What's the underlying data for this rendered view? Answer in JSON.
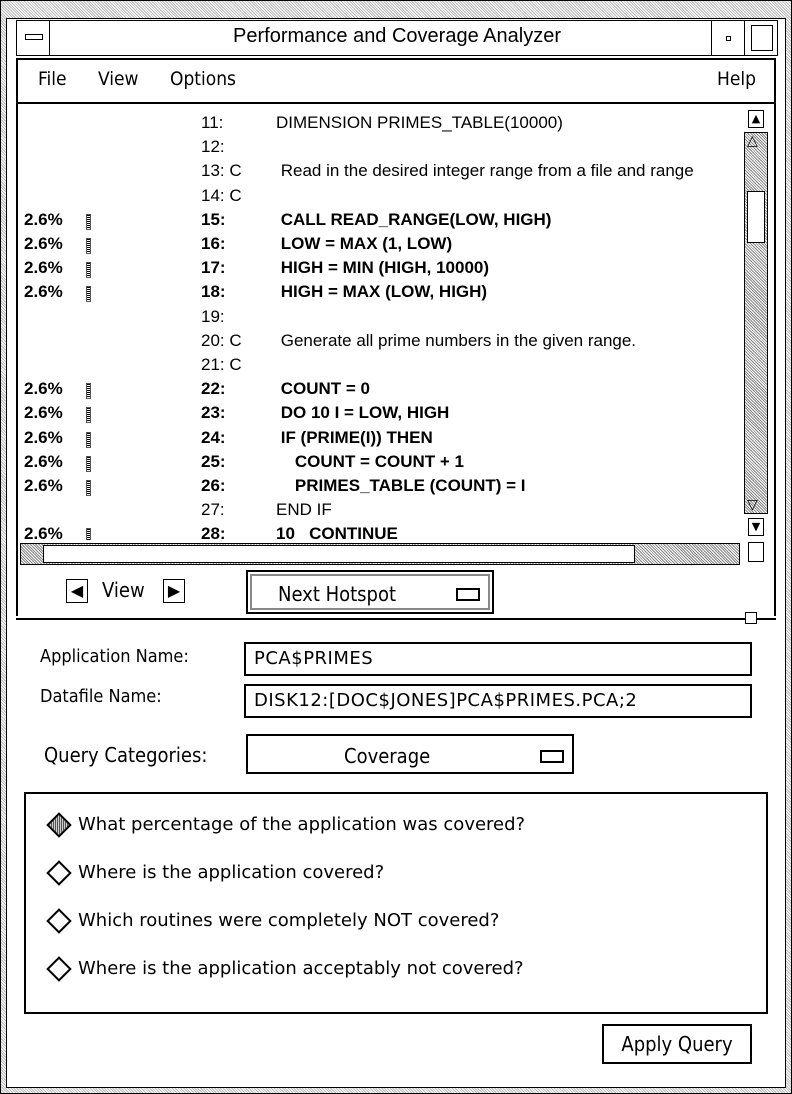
{
  "window": {
    "title": "Performance and Coverage Analyzer"
  },
  "menu": {
    "file": "File",
    "view": "View",
    "options": "Options",
    "help": "Help"
  },
  "source_lines": [
    {
      "pct": "",
      "num": "11:",
      "text": "DIMENSION PRIMES_TABLE(10000)",
      "executed": false
    },
    {
      "pct": "",
      "num": "12:",
      "text": "",
      "executed": false
    },
    {
      "pct": "",
      "num": "13: C",
      "text": " Read in the desired integer range from a file and range",
      "executed": false
    },
    {
      "pct": "",
      "num": "14: C",
      "text": "",
      "executed": false
    },
    {
      "pct": "2.6%",
      "num": "15:",
      "text": " CALL READ_RANGE(LOW, HIGH)",
      "executed": true
    },
    {
      "pct": "2.6%",
      "num": "16:",
      "text": " LOW = MAX (1, LOW)",
      "executed": true
    },
    {
      "pct": "2.6%",
      "num": "17:",
      "text": " HIGH = MIN (HIGH, 10000)",
      "executed": true
    },
    {
      "pct": "2.6%",
      "num": "18:",
      "text": " HIGH = MAX (LOW, HIGH)",
      "executed": true
    },
    {
      "pct": "",
      "num": "19:",
      "text": "",
      "executed": false
    },
    {
      "pct": "",
      "num": "20: C",
      "text": " Generate all prime numbers in the given range.",
      "executed": false
    },
    {
      "pct": "",
      "num": "21: C",
      "text": "",
      "executed": false
    },
    {
      "pct": "2.6%",
      "num": "22:",
      "text": " COUNT = 0",
      "executed": true
    },
    {
      "pct": "2.6%",
      "num": "23:",
      "text": " DO 10 I = LOW, HIGH",
      "executed": true
    },
    {
      "pct": "2.6%",
      "num": "24:",
      "text": " IF (PRIME(I)) THEN",
      "executed": true
    },
    {
      "pct": "2.6%",
      "num": "25:",
      "text": "    COUNT = COUNT + 1",
      "executed": true
    },
    {
      "pct": "2.6%",
      "num": "26:",
      "text": "    PRIMES_TABLE (COUNT) = I",
      "executed": true
    },
    {
      "pct": "",
      "num": "27:",
      "text": "END IF",
      "executed": false
    },
    {
      "pct": "2.6%",
      "num": "28:",
      "text": "10   CONTINUE",
      "executed": true
    }
  ],
  "view_nav": {
    "label": "View"
  },
  "hotspot_menu": {
    "selected": "Next Hotspot"
  },
  "form": {
    "app_name_label": "Application Name:",
    "app_name_value": "PCA$PRIMES",
    "datafile_label": "Datafile Name:",
    "datafile_value": "DISK12:[DOC$JONES]PCA$PRIMES.PCA;2",
    "query_label": "Query Categories:",
    "query_value": "Coverage"
  },
  "queries": [
    {
      "label": "What percentage of the application was covered?",
      "selected": true
    },
    {
      "label": "Where is the application covered?",
      "selected": false
    },
    {
      "label": "Which routines were completely NOT covered?",
      "selected": false
    },
    {
      "label": "Where is the application acceptably not covered?",
      "selected": false
    }
  ],
  "apply_button": "Apply Query"
}
